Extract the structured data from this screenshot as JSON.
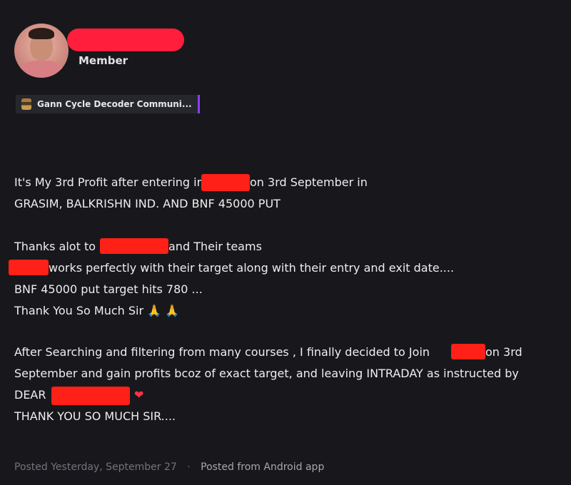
{
  "author": {
    "role": "Member"
  },
  "community": {
    "label": "Gann Cycle Decoder Communi..."
  },
  "post": {
    "line1a": "It's My 3rd Profit after entering in",
    "line1b": "on 3rd September in",
    "line2": "GRASIM, BALKRISHN IND. AND BNF 45000 PUT",
    "line3a": "Thanks alot to",
    "line3b": "and Their teams",
    "line4": "works perfectly with their target along with their entry and exit date....",
    "line5": "BNF 45000 put target hits 780 ...",
    "line6": "Thank You So Much Sir",
    "line6_emoji": "🙏 🙏",
    "line7a": "After Searching and filtering from many courses , I finally decided to Join",
    "line7b": "on 3rd",
    "line8": "September and gain profits bcoz of exact target, and leaving INTRADAY as instructed by",
    "line9": "DEAR",
    "line9_heart": "❤",
    "line10": "THANK YOU SO MUCH SIR...."
  },
  "footer": {
    "posted": "Posted Yesterday, September 27",
    "separator": "·",
    "source": "Posted from Android app"
  },
  "colors": {
    "background": "#18181c",
    "redaction": "#ff2018",
    "chip_accent": "#8a3dff"
  }
}
